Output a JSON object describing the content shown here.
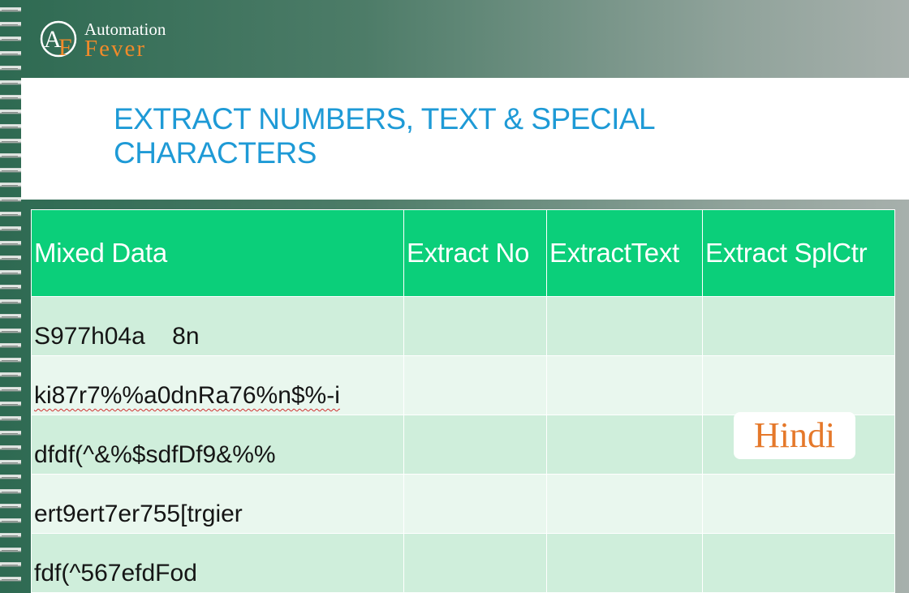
{
  "logo": {
    "letters": "AF",
    "line1": "Automation",
    "line2": "Fever"
  },
  "slide": {
    "title_line1": "EXTRACT NUMBERS, TEXT & SPECIAL",
    "title_line2": "CHARACTERS"
  },
  "table": {
    "headers": [
      "Mixed Data",
      "Extract No",
      "ExtractText",
      "Extract SplCtr"
    ],
    "rows": [
      [
        "S977h04a    8n",
        "",
        "",
        ""
      ],
      [
        "ki87r7%%a0dnRa76%n$%-i",
        "",
        "",
        ""
      ],
      [
        "dfdf(^&%$sdfDf9&%%",
        "",
        "",
        ""
      ],
      [
        "ert9ert7er755[trgier",
        "",
        "",
        ""
      ],
      [
        "fdf(^567efdFod",
        "",
        "",
        ""
      ]
    ]
  },
  "badge": {
    "label": "Hindi"
  },
  "colors": {
    "header_green": "#0bcf7a",
    "title_blue": "#1e9ad6",
    "badge_orange": "#e5782a",
    "row_odd": "#cfeedb",
    "row_even": "#e9f7ee"
  }
}
